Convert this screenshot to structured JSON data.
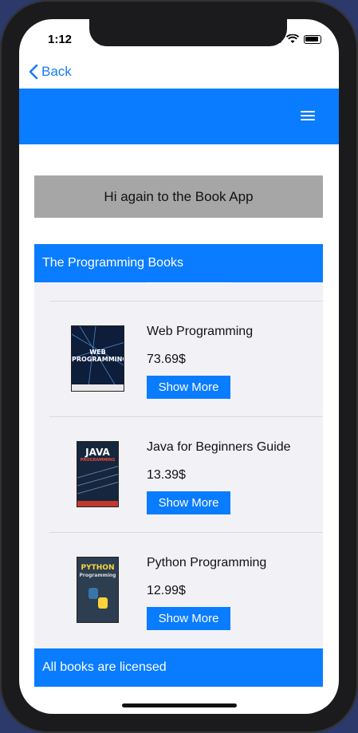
{
  "status_bar": {
    "time": "1:12"
  },
  "nav": {
    "back_label": "Back"
  },
  "greeting": "Hi again to the Book App",
  "section_title": "The Programming Books",
  "books": [
    {
      "title": "Web Programming",
      "price": "73.69$",
      "button_label": "Show More",
      "cover_text": "WEB PROGRAMMING"
    },
    {
      "title": "Java for Beginners Guide",
      "price": "13.39$",
      "button_label": "Show More",
      "cover_text": "JAVA"
    },
    {
      "title": "Python Programming",
      "price": "12.99$",
      "button_label": "Show More",
      "cover_text": "PYTHON"
    }
  ],
  "footer_text": "All books are licensed",
  "colors": {
    "accent": "#0a7cff",
    "banner": "#a6a6a6",
    "list_bg": "#f2f1f6"
  }
}
